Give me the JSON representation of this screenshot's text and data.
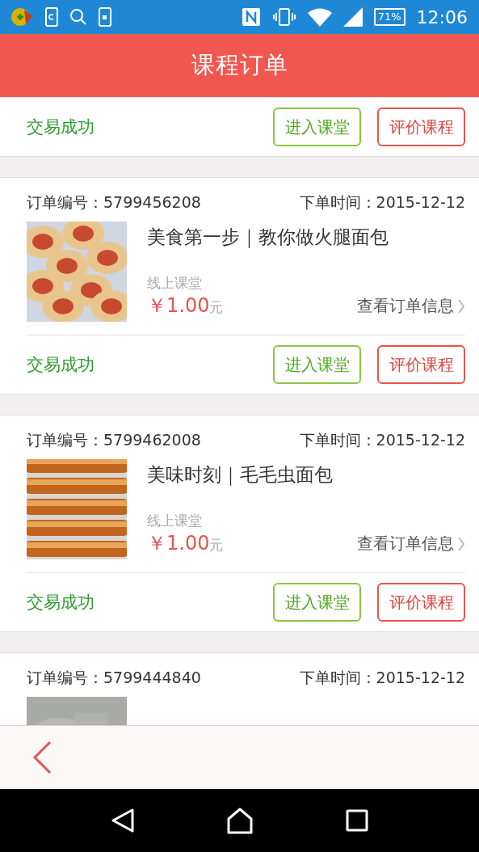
{
  "status_bar": {
    "battery": "71%",
    "time": "12:06"
  },
  "header": {
    "title": "课程订单"
  },
  "orders": [
    {
      "status": "交易成功",
      "actions": [
        "进入课堂",
        "评价课程"
      ]
    },
    {
      "order_no": "订单编号：5799456208",
      "order_time": "下单时间：2015-12-12",
      "title": "美食第一步｜教你做火腿面包",
      "type": "线上课堂",
      "price": "￥1.00",
      "unit": "元",
      "detail_link": "查看订单信息",
      "status": "交易成功",
      "actions": [
        "进入课堂",
        "评价课程"
      ]
    },
    {
      "order_no": "订单编号：5799462008",
      "order_time": "下单时间：2015-12-12",
      "title": "美味时刻｜毛毛虫面包",
      "type": "线上课堂",
      "price": "￥1.00",
      "unit": "元",
      "detail_link": "查看订单信息",
      "status": "交易成功",
      "actions": [
        "进入课堂",
        "评价课程"
      ]
    },
    {
      "order_no": "订单编号：5799444840",
      "order_time": "下单时间：2015-12-12"
    }
  ]
}
